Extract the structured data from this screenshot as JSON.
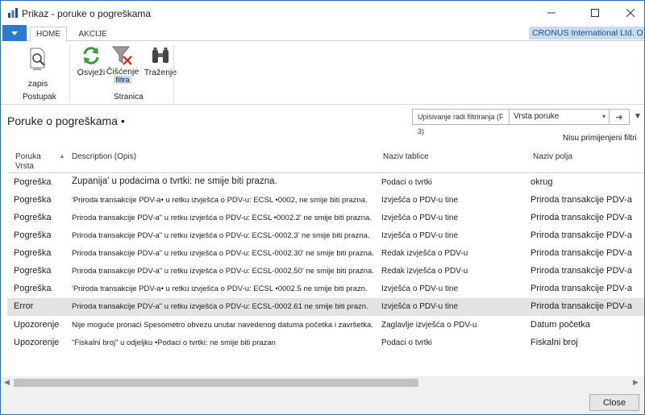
{
  "window": {
    "title": "Prikaz - poruke o pogreškama"
  },
  "ribbon": {
    "tabs": [
      "HOME",
      "AKCIJE"
    ],
    "company": "CRONUS International Ltd. O",
    "buttons": {
      "zapis": "zapis",
      "osvjezi": "Osvježi",
      "ciscenje_line1": "Čišćenje",
      "ciscenje_line2": "filtra",
      "trazenje": "Traženje"
    },
    "groups": {
      "postupak": "Postupak",
      "stranica": "Stranica"
    }
  },
  "page": {
    "title": "Poruke o pogreškama •",
    "filter_hint": "Upisivanje radi filtriranja (F 3)",
    "filter_field": "Vrsta poruke",
    "no_filters": "Nisu primijenjeni filtri"
  },
  "table": {
    "headers": {
      "type_line1": "Poruka",
      "type_line2": "Vrsta",
      "description": "Description (Opis)",
      "table": "Naziv tablice",
      "field": "Naziv polja"
    },
    "rows": [
      {
        "type": "Pogreška",
        "description": "Županija' u podacima o tvrtki: ne smije biti prazna.",
        "table": "Podaci o tvrtki",
        "field": "okrug"
      },
      {
        "type": "Pogreška",
        "description": "'Priroda transakcije PDV-a• u retku izvješća o PDV-u: ECSL •0002, ne smije biti prazna.",
        "table": "Izvješća o PDV-u tine",
        "field": "Priroda transakcije PDV-a"
      },
      {
        "type": "Pogreška",
        "description": "Priroda transakcije PDV-a\" u retku izvješća o PDV-u: ECSL •0002.2' ne smije biti prazna.",
        "table": "Izvješća o PDV-u tine",
        "field": "Priroda transakcije PDV-a"
      },
      {
        "type": "Pogreška",
        "description": "Priroda transakcije PDV-a\" u retku izvješća o PDV-u: ECSL-0002,3' ne smije biti prazna.",
        "table": "Izvješća o PDV-u tine",
        "field": "Priroda transakcije PDV-a"
      },
      {
        "type": "Pogreška",
        "description": "Priroda transakcije PDV-a\" u retku izvješća o PDV-u: ECSL-0002.30' ne smije biti prazna.",
        "table": "Redak izvješća o PDV-u",
        "field": "Priroda transakcije PDV-a"
      },
      {
        "type": "Pogreška",
        "description": "Priroda transakcije PDV-a\" u retku izvješća o PDV-u: ECSL-0002,50' ne smije biti prazna.",
        "table": "Redak izvješća o PDV-u",
        "field": "Priroda transakcije PDV-a"
      },
      {
        "type": "Pogreška",
        "description": "'Priroda transakcije PDV-a• u retku izvješća o PDV-u: ECSL •0002.5 ne smije biti prazn.",
        "table": "Izvješća o PDV-u tine",
        "field": "Priroda transakcije PDV-a"
      },
      {
        "type": "Error",
        "description": "Priroda transakcije PDV-a\" u retku izvješća o PDV-u: ECSL-0002.61 ne smije biti prazn.",
        "table": "Izvješća o PDV-u tine",
        "field": "Priroda transakcije PDV-a"
      },
      {
        "type": "Upozorenje",
        "description": "Nije moguće pronaći Spesometro obvezu unutar navedenog datuma početka i završetka.",
        "table": "Zaglavlje izvješća o PDV-u",
        "field": "Datum početka"
      },
      {
        "type": "Upozorenje",
        "description": "\"Fiskalni broj\" u odjeljku •Podaci o tvrtki: ne smije biti prazan",
        "table": "Podaci o tvrtki",
        "field": "Fiskalni broj"
      }
    ]
  },
  "footer": {
    "close": "Close"
  },
  "icons": {
    "app": "app-logo-icon",
    "record": "record-search-icon",
    "refresh": "refresh-icon",
    "clear_filter": "clear-filter-icon",
    "find": "binoculars-icon"
  },
  "colors": {
    "accent": "#2b79d0",
    "company_bg": "#c7dcf0",
    "selected_row": "#e3e3e3"
  }
}
